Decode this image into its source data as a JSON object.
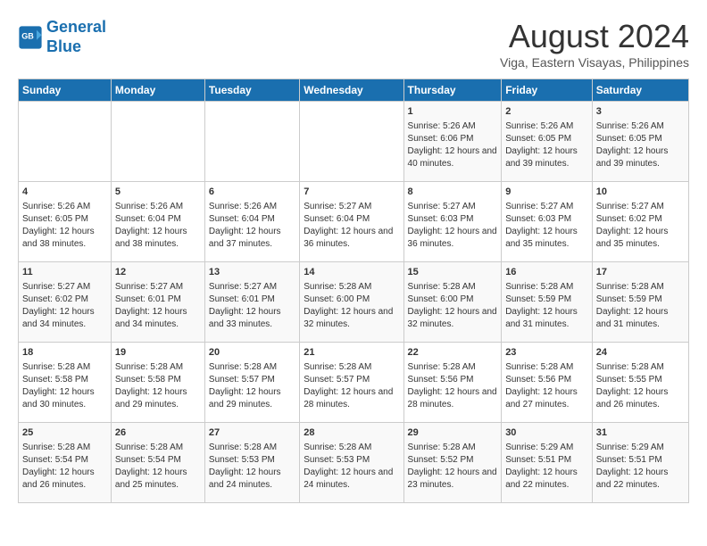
{
  "header": {
    "logo_line1": "General",
    "logo_line2": "Blue",
    "title": "August 2024",
    "subtitle": "Viga, Eastern Visayas, Philippines"
  },
  "days_of_week": [
    "Sunday",
    "Monday",
    "Tuesday",
    "Wednesday",
    "Thursday",
    "Friday",
    "Saturday"
  ],
  "weeks": [
    [
      {
        "day": "",
        "text": ""
      },
      {
        "day": "",
        "text": ""
      },
      {
        "day": "",
        "text": ""
      },
      {
        "day": "",
        "text": ""
      },
      {
        "day": "1",
        "text": "Sunrise: 5:26 AM\nSunset: 6:06 PM\nDaylight: 12 hours and 40 minutes."
      },
      {
        "day": "2",
        "text": "Sunrise: 5:26 AM\nSunset: 6:05 PM\nDaylight: 12 hours and 39 minutes."
      },
      {
        "day": "3",
        "text": "Sunrise: 5:26 AM\nSunset: 6:05 PM\nDaylight: 12 hours and 39 minutes."
      }
    ],
    [
      {
        "day": "4",
        "text": "Sunrise: 5:26 AM\nSunset: 6:05 PM\nDaylight: 12 hours and 38 minutes."
      },
      {
        "day": "5",
        "text": "Sunrise: 5:26 AM\nSunset: 6:04 PM\nDaylight: 12 hours and 38 minutes."
      },
      {
        "day": "6",
        "text": "Sunrise: 5:26 AM\nSunset: 6:04 PM\nDaylight: 12 hours and 37 minutes."
      },
      {
        "day": "7",
        "text": "Sunrise: 5:27 AM\nSunset: 6:04 PM\nDaylight: 12 hours and 36 minutes."
      },
      {
        "day": "8",
        "text": "Sunrise: 5:27 AM\nSunset: 6:03 PM\nDaylight: 12 hours and 36 minutes."
      },
      {
        "day": "9",
        "text": "Sunrise: 5:27 AM\nSunset: 6:03 PM\nDaylight: 12 hours and 35 minutes."
      },
      {
        "day": "10",
        "text": "Sunrise: 5:27 AM\nSunset: 6:02 PM\nDaylight: 12 hours and 35 minutes."
      }
    ],
    [
      {
        "day": "11",
        "text": "Sunrise: 5:27 AM\nSunset: 6:02 PM\nDaylight: 12 hours and 34 minutes."
      },
      {
        "day": "12",
        "text": "Sunrise: 5:27 AM\nSunset: 6:01 PM\nDaylight: 12 hours and 34 minutes."
      },
      {
        "day": "13",
        "text": "Sunrise: 5:27 AM\nSunset: 6:01 PM\nDaylight: 12 hours and 33 minutes."
      },
      {
        "day": "14",
        "text": "Sunrise: 5:28 AM\nSunset: 6:00 PM\nDaylight: 12 hours and 32 minutes."
      },
      {
        "day": "15",
        "text": "Sunrise: 5:28 AM\nSunset: 6:00 PM\nDaylight: 12 hours and 32 minutes."
      },
      {
        "day": "16",
        "text": "Sunrise: 5:28 AM\nSunset: 5:59 PM\nDaylight: 12 hours and 31 minutes."
      },
      {
        "day": "17",
        "text": "Sunrise: 5:28 AM\nSunset: 5:59 PM\nDaylight: 12 hours and 31 minutes."
      }
    ],
    [
      {
        "day": "18",
        "text": "Sunrise: 5:28 AM\nSunset: 5:58 PM\nDaylight: 12 hours and 30 minutes."
      },
      {
        "day": "19",
        "text": "Sunrise: 5:28 AM\nSunset: 5:58 PM\nDaylight: 12 hours and 29 minutes."
      },
      {
        "day": "20",
        "text": "Sunrise: 5:28 AM\nSunset: 5:57 PM\nDaylight: 12 hours and 29 minutes."
      },
      {
        "day": "21",
        "text": "Sunrise: 5:28 AM\nSunset: 5:57 PM\nDaylight: 12 hours and 28 minutes."
      },
      {
        "day": "22",
        "text": "Sunrise: 5:28 AM\nSunset: 5:56 PM\nDaylight: 12 hours and 28 minutes."
      },
      {
        "day": "23",
        "text": "Sunrise: 5:28 AM\nSunset: 5:56 PM\nDaylight: 12 hours and 27 minutes."
      },
      {
        "day": "24",
        "text": "Sunrise: 5:28 AM\nSunset: 5:55 PM\nDaylight: 12 hours and 26 minutes."
      }
    ],
    [
      {
        "day": "25",
        "text": "Sunrise: 5:28 AM\nSunset: 5:54 PM\nDaylight: 12 hours and 26 minutes."
      },
      {
        "day": "26",
        "text": "Sunrise: 5:28 AM\nSunset: 5:54 PM\nDaylight: 12 hours and 25 minutes."
      },
      {
        "day": "27",
        "text": "Sunrise: 5:28 AM\nSunset: 5:53 PM\nDaylight: 12 hours and 24 minutes."
      },
      {
        "day": "28",
        "text": "Sunrise: 5:28 AM\nSunset: 5:53 PM\nDaylight: 12 hours and 24 minutes."
      },
      {
        "day": "29",
        "text": "Sunrise: 5:28 AM\nSunset: 5:52 PM\nDaylight: 12 hours and 23 minutes."
      },
      {
        "day": "30",
        "text": "Sunrise: 5:29 AM\nSunset: 5:51 PM\nDaylight: 12 hours and 22 minutes."
      },
      {
        "day": "31",
        "text": "Sunrise: 5:29 AM\nSunset: 5:51 PM\nDaylight: 12 hours and 22 minutes."
      }
    ]
  ]
}
